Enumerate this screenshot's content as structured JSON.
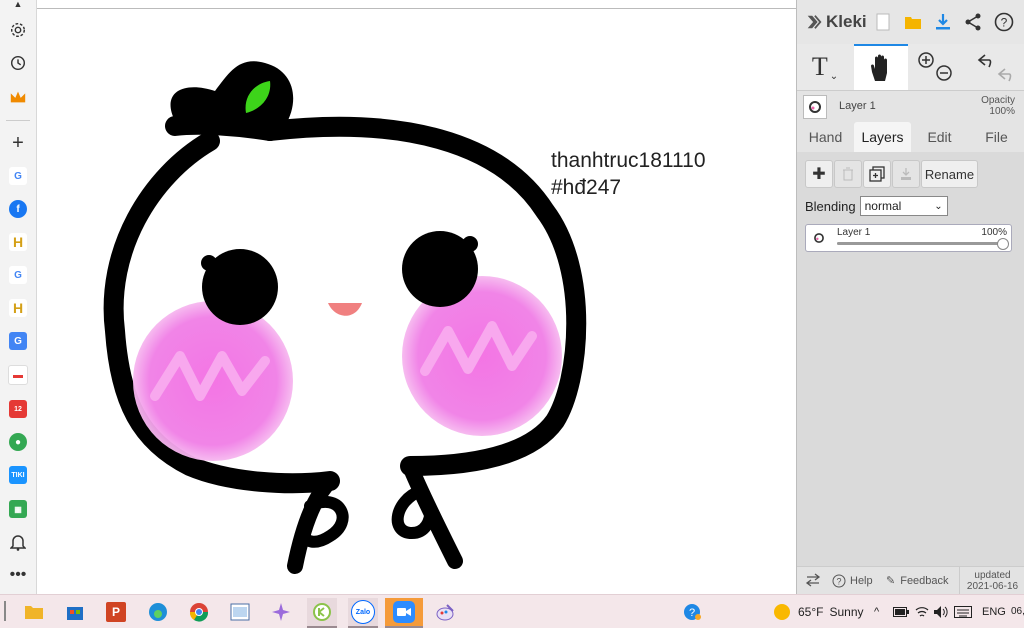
{
  "canvas": {
    "caption_line1": "thanhtruc181110",
    "caption_line2": "#hđ247"
  },
  "panel": {
    "logo_text": "Kleki",
    "layer_name": "Layer 1",
    "opacity_label": "Opacity",
    "opacity_value": "100%",
    "tabs": [
      {
        "label": "Hand"
      },
      {
        "label": "Layers"
      },
      {
        "label": "Edit"
      },
      {
        "label": "File"
      }
    ],
    "rename_label": "Rename",
    "blending_label": "Blending",
    "blending_value": "normal",
    "layer_card": {
      "name": "Layer 1",
      "opacity": "100%",
      "opacity_fraction": 1.0
    },
    "footer": {
      "help": "Help",
      "feedback": "Feedback",
      "updated_label": "updated",
      "updated_date": "2021-06-16"
    }
  },
  "taskbar": {
    "weather_temp": "65°F",
    "weather_text": "Sunny",
    "language": "ENG",
    "clock_partial": "06,"
  },
  "colors": {
    "accent_blue": "#1e88e5",
    "blush_pink": "#f36ee3",
    "leaf_green": "#3dd41a"
  }
}
